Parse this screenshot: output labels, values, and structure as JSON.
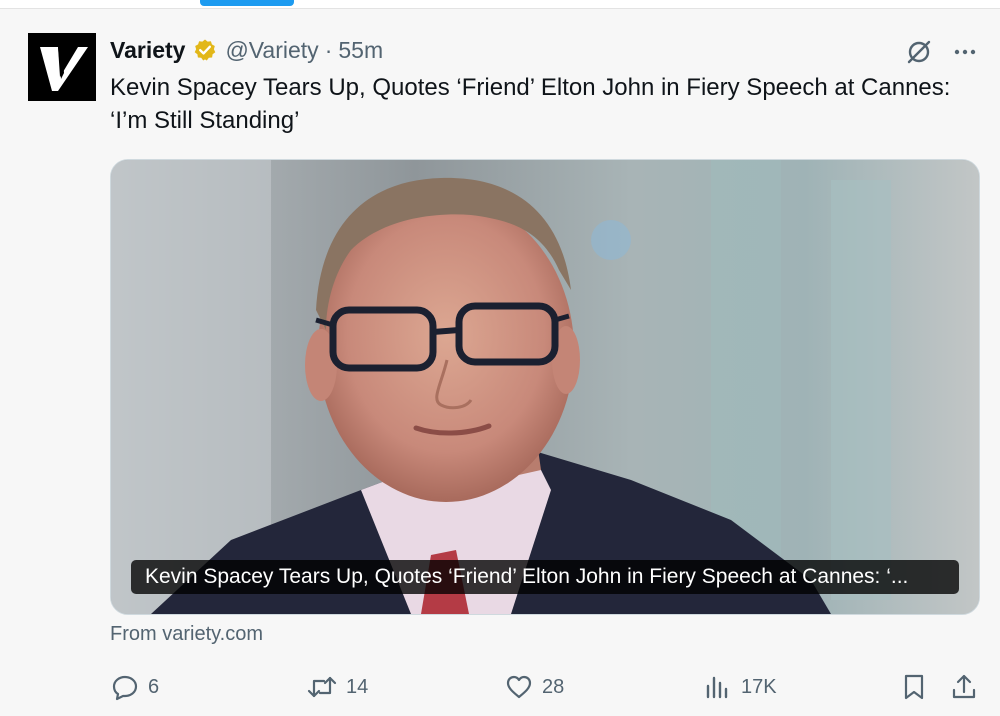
{
  "tweet": {
    "display_name": "Variety",
    "verified": true,
    "handle": "@Variety",
    "separator": "·",
    "time": "55m",
    "text": "Kevin Spacey Tears Up, Quotes ‘Friend’ Elton John in Fiery Speech at Cannes: ‘I’m Still Standing’"
  },
  "card": {
    "caption": "Kevin Spacey Tears Up, Quotes ‘Friend’ Elton John in Fiery Speech at Cannes: ‘...",
    "source": "From variety.com"
  },
  "actions": {
    "replies": "6",
    "retweets": "14",
    "likes": "28",
    "views": "17K"
  },
  "icons": {
    "verified": "verified-badge-icon",
    "grok": "grok-icon",
    "more": "more-icon",
    "reply": "reply-icon",
    "retweet": "retweet-icon",
    "like": "heart-icon",
    "views": "views-icon",
    "bookmark": "bookmark-icon",
    "share": "share-icon"
  },
  "colors": {
    "accent": "#1d9bf0",
    "verified_gold": "#e2b719",
    "secondary_text": "#536471"
  }
}
